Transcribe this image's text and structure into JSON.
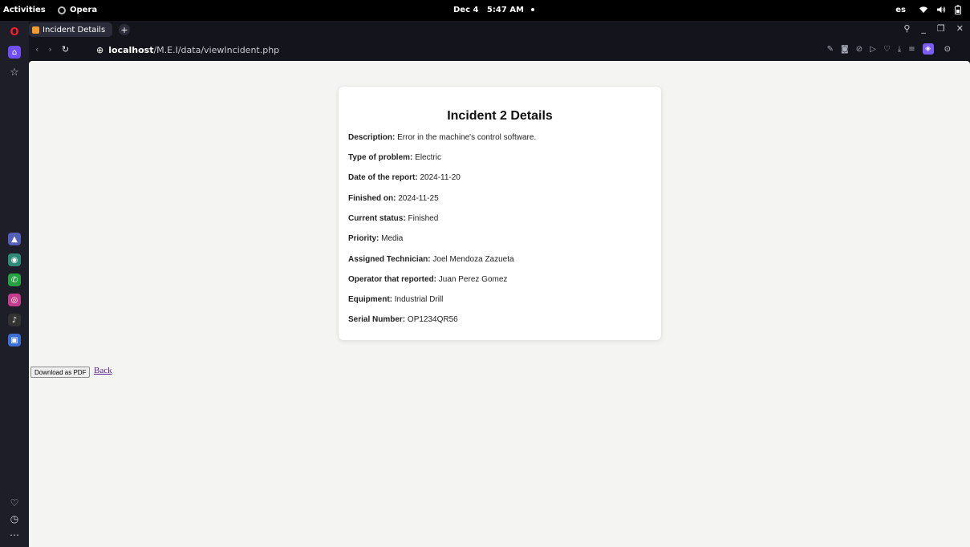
{
  "system_bar": {
    "activities": "Activities",
    "app_name": "Opera",
    "date": "Dec 4",
    "time": "5:47 AM",
    "language": "es"
  },
  "browser": {
    "tab_title": "Incident Details",
    "url_host": "localhost",
    "url_path": "/M.E.I/data/viewIncident.php"
  },
  "page": {
    "title": "Incident 2 Details",
    "fields": [
      {
        "label": "Description:",
        "value": "Error in the machine's control software."
      },
      {
        "label": "Type of problem:",
        "value": "Electric"
      },
      {
        "label": "Date of the report:",
        "value": "2024-11-20"
      },
      {
        "label": "Finished on:",
        "value": "2024-11-25"
      },
      {
        "label": "Current status:",
        "value": "Finished"
      },
      {
        "label": "Priority:",
        "value": "Media"
      },
      {
        "label": "Assigned Technician:",
        "value": "Joel Mendoza Zazueta"
      },
      {
        "label": "Operator that reported:",
        "value": "Juan Perez Gomez"
      },
      {
        "label": "Equipment:",
        "value": "Industrial Drill"
      },
      {
        "label": "Serial Number:",
        "value": "OP1234QR56"
      }
    ],
    "pdf_button": "Download as PDF",
    "back_link": "Back"
  },
  "colors": {
    "opera_red": "#ff1b2d",
    "accent_purple": "#6f4ef2",
    "visited_link": "#551a8b"
  }
}
